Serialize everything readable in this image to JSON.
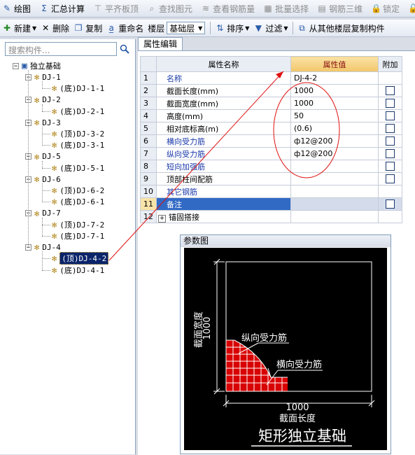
{
  "toolbar1": {
    "items": [
      {
        "label": "绘图",
        "icon": "draw-icon",
        "enabled": true
      },
      {
        "label": "汇总计算",
        "icon": "sigma-icon",
        "enabled": true
      },
      {
        "label": "平齐板顶",
        "icon": "align-top-icon",
        "enabled": false
      },
      {
        "label": "查找图元",
        "icon": "find-icon",
        "enabled": false
      },
      {
        "label": "查看钢筋量",
        "icon": "rebar-view-icon",
        "enabled": false
      },
      {
        "label": "批量选择",
        "icon": "batch-select-icon",
        "enabled": false
      },
      {
        "label": "钢筋三维",
        "icon": "rebar-3d-icon",
        "enabled": false
      },
      {
        "label": "锁定",
        "icon": "lock-icon",
        "enabled": false
      },
      {
        "label": "解",
        "icon": "unlock-icon",
        "enabled": false
      }
    ]
  },
  "toolbar2": {
    "new_label": "新建",
    "delete_label": "删除",
    "copy_label": "复制",
    "rename_label": "重命名",
    "floor_label": "楼层",
    "floor_value": "基础层",
    "sort_label": "排序",
    "filter_label": "过滤",
    "copy_from_floor_label": "从其他楼层复制构件"
  },
  "left": {
    "search_placeholder": "搜索构件...",
    "root_label": "独立基础",
    "groups": [
      {
        "label": "DJ-1",
        "children": [
          "(底)DJ-1-1"
        ]
      },
      {
        "label": "DJ-2",
        "children": [
          "(底)DJ-2-1"
        ]
      },
      {
        "label": "DJ-3",
        "children": [
          "(顶)DJ-3-2",
          "(底)DJ-3-1"
        ]
      },
      {
        "label": "DJ-5",
        "children": [
          "(底)DJ-5-1"
        ]
      },
      {
        "label": "DJ-6",
        "children": [
          "(顶)DJ-6-2",
          "(底)DJ-6-1"
        ]
      },
      {
        "label": "DJ-7",
        "children": [
          "(顶)DJ-7-2",
          "(底)DJ-7-1"
        ]
      },
      {
        "label": "DJ-4",
        "children": [
          "(顶)DJ-4-2",
          "(底)DJ-4-1"
        ]
      }
    ],
    "selected": "(顶)DJ-4-2"
  },
  "props": {
    "tab_label": "属性编辑",
    "col_name": "属性名称",
    "col_value": "属性值",
    "col_add": "附加",
    "rows": [
      {
        "num": "1",
        "name": "名称",
        "value": "DJ-4-2",
        "blue": true,
        "check": false
      },
      {
        "num": "2",
        "name": "截面长度(mm)",
        "value": "1000",
        "blue": false,
        "check": true
      },
      {
        "num": "3",
        "name": "截面宽度(mm)",
        "value": "1000",
        "blue": false,
        "check": true
      },
      {
        "num": "4",
        "name": "高度(mm)",
        "value": "50",
        "blue": false,
        "check": true
      },
      {
        "num": "5",
        "name": "相对底标高(m)",
        "value": "(0.6)",
        "blue": false,
        "check": true
      },
      {
        "num": "6",
        "name": "横向受力筋",
        "value": "ф12@200",
        "blue": true,
        "check": true
      },
      {
        "num": "7",
        "name": "纵向受力筋",
        "value": "ф12@200",
        "blue": true,
        "check": true
      },
      {
        "num": "8",
        "name": "短向加强筋",
        "value": "",
        "blue": true,
        "check": true
      },
      {
        "num": "9",
        "name": "顶部柱间配筋",
        "value": "",
        "blue": false,
        "check": true
      },
      {
        "num": "10",
        "name": "其它钢筋",
        "value": "",
        "blue": true,
        "check": false
      },
      {
        "num": "11",
        "name": "备注",
        "value": "",
        "blue": false,
        "check": true,
        "selected": true
      },
      {
        "num": "12",
        "name": "锚固搭接",
        "value": "",
        "blue": false,
        "check": false,
        "expander": true
      }
    ]
  },
  "figure": {
    "title": "参数图",
    "width_label": "截面宽度",
    "width_value": "1000",
    "length_label": "截面长度",
    "length_value": "1000",
    "longitudinal_label": "纵向受力筋",
    "transverse_label": "横向受力筋",
    "caption": "矩形独立基础"
  },
  "colors": {
    "annotation_red": "#e01010",
    "selection_blue": "#316ac5",
    "header_highlight": "#f2c66a"
  }
}
